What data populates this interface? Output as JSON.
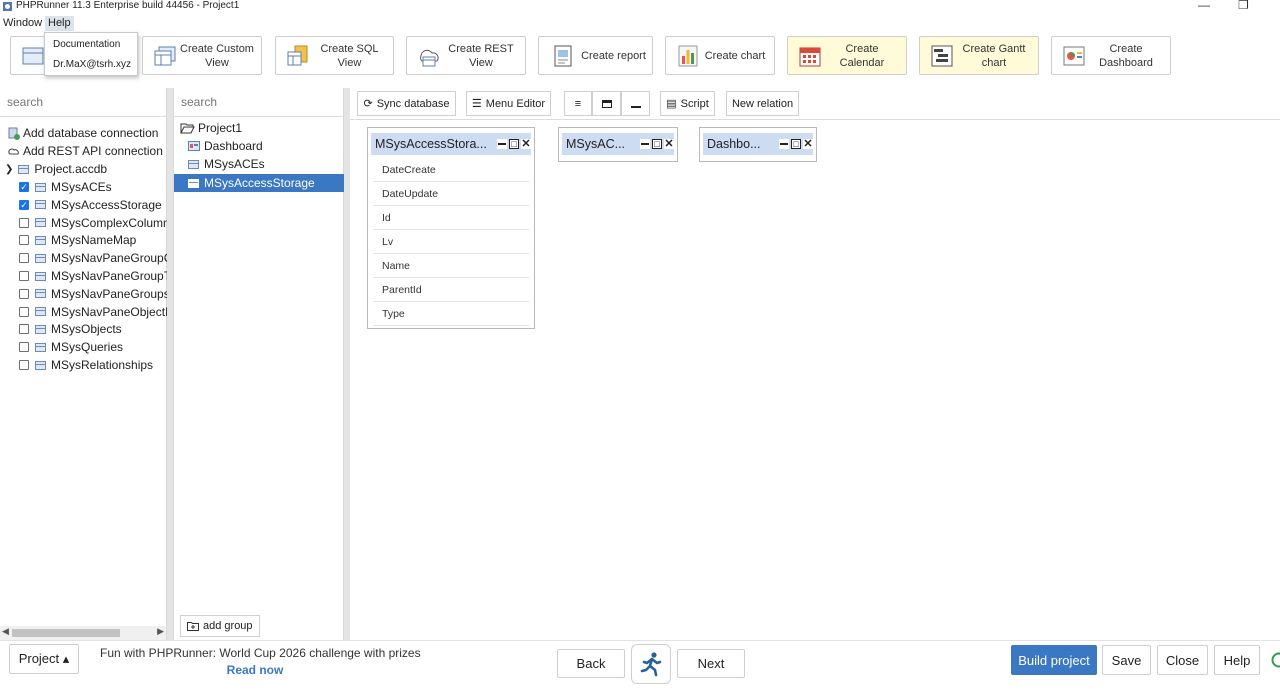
{
  "window": {
    "title": "PHPRunner 11.3 Enterprise build 44456 - Project1",
    "minimize_glyph": "—",
    "restore_glyph": "❐"
  },
  "menubar": {
    "window": "Window",
    "help": "Help"
  },
  "help_menu": {
    "items": [
      "Documentation",
      "Dr.MaX@tsrh.xyz"
    ]
  },
  "toolbar": {
    "buttons": [
      {
        "label": "Create Custom View",
        "icon": "custom-view-icon"
      },
      {
        "label": "Create SQL View",
        "icon": "sql-view-icon"
      },
      {
        "label": "Create REST View",
        "icon": "rest-view-icon"
      },
      {
        "label": "Create report",
        "icon": "report-icon"
      },
      {
        "label": "Create chart",
        "icon": "chart-icon"
      },
      {
        "label": "Create Calendar",
        "icon": "calendar-icon"
      },
      {
        "label": "Create Gantt chart",
        "icon": "gantt-icon"
      },
      {
        "label": "Create Dashboard",
        "icon": "dashboard-icon"
      }
    ]
  },
  "left_panel": {
    "search_placeholder": "search",
    "add_db": "Add database connection",
    "add_rest": "Add REST API connection",
    "db_name": "Project.accdb",
    "tables": [
      {
        "name": "MSysACEs",
        "checked": true
      },
      {
        "name": "MSysAccessStorage",
        "checked": true
      },
      {
        "name": "MSysComplexColumns",
        "checked": false
      },
      {
        "name": "MSysNameMap",
        "checked": false
      },
      {
        "name": "MSysNavPaneGroupCategories",
        "checked": false
      },
      {
        "name": "MSysNavPaneGroupToObjects",
        "checked": false
      },
      {
        "name": "MSysNavPaneGroups",
        "checked": false
      },
      {
        "name": "MSysNavPaneObjectIDs",
        "checked": false
      },
      {
        "name": "MSysObjects",
        "checked": false
      },
      {
        "name": "MSysQueries",
        "checked": false
      },
      {
        "name": "MSysRelationships",
        "checked": false
      }
    ]
  },
  "mid_panel": {
    "search_placeholder": "search",
    "project": "Project1",
    "items": [
      "Dashboard",
      "MSysACEs",
      "MSysAccessStorage"
    ],
    "selected": "MSysAccessStorage",
    "add_group": "add group"
  },
  "canvas_toolbar": {
    "sync": "Sync database",
    "menu_editor": "Menu Editor",
    "script": "Script",
    "new_relation": "New relation"
  },
  "entities": [
    {
      "name": "MSysAccessStora...",
      "fields": [
        "DateCreate",
        "DateUpdate",
        "Id",
        "Lv",
        "Name",
        "ParentId",
        "Type"
      ]
    },
    {
      "name": "MSysAC...",
      "fields": []
    },
    {
      "name": "Dashbo...",
      "fields": []
    }
  ],
  "footer": {
    "project": "Project ▴",
    "promo_text": "Fun with PHPRunner: World Cup 2026 challenge with prizes",
    "promo_link": "Read now",
    "back": "Back",
    "next": "Next",
    "build": "Build project",
    "save": "Save",
    "close": "Close",
    "help": "Help"
  },
  "colors": {
    "accent": "#3b78c4",
    "entity_header": "#cddcf3",
    "yellow_button": "#fffbd9"
  }
}
